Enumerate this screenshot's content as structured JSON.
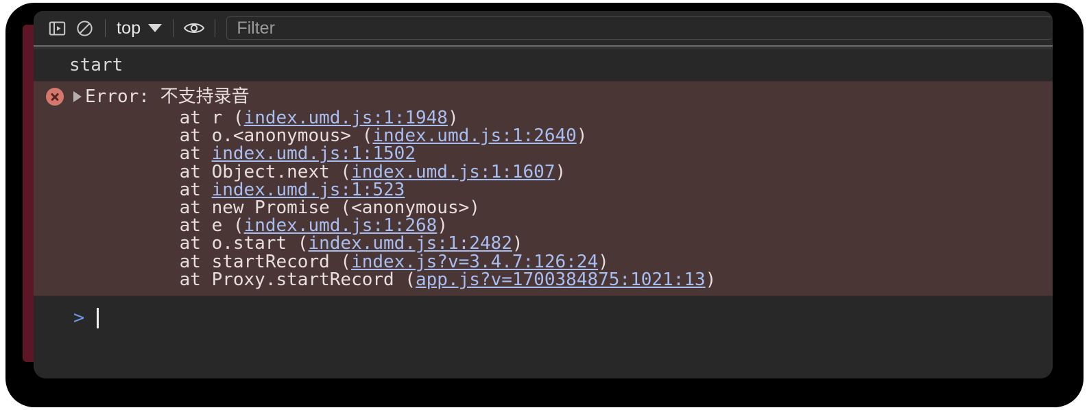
{
  "window": {
    "app": "Chrome DevTools Console"
  },
  "toolbar": {
    "sidebar_toggle_icon": "console-sidebar-icon",
    "clear_console_icon": "clear-console-icon",
    "context_label": "top",
    "context_caret_icon": "chevron-down-icon",
    "eye_icon": "live-expression-eye-icon",
    "filter_placeholder": "Filter",
    "filter_value": ""
  },
  "console": {
    "messages": [
      {
        "type": "log",
        "text": "start"
      },
      {
        "type": "error",
        "icon": "error-circle-icon",
        "expander_icon": "disclosure-triangle-icon",
        "title": "Error: 不支持录音",
        "stack": [
          {
            "prefix": "    at r (",
            "link": "index.umd.js:1:1948",
            "suffix": ")"
          },
          {
            "prefix": "    at o.<anonymous> (",
            "link": "index.umd.js:1:2640",
            "suffix": ")"
          },
          {
            "prefix": "    at ",
            "link": "index.umd.js:1:1502",
            "suffix": ""
          },
          {
            "prefix": "    at Object.next (",
            "link": "index.umd.js:1:1607",
            "suffix": ")"
          },
          {
            "prefix": "    at ",
            "link": "index.umd.js:1:523",
            "suffix": ""
          },
          {
            "prefix": "    at new Promise (<anonymous>)",
            "link": "",
            "suffix": ""
          },
          {
            "prefix": "    at e (",
            "link": "index.umd.js:1:268",
            "suffix": ")"
          },
          {
            "prefix": "    at o.start (",
            "link": "index.umd.js:1:2482",
            "suffix": ")"
          },
          {
            "prefix": "    at startRecord (",
            "link": "index.js?v=3.4.7:126:24",
            "suffix": ")"
          },
          {
            "prefix": "    at Proxy.startRecord (",
            "link": "app.js?v=1700384875:1021:13",
            "suffix": ")"
          }
        ]
      }
    ],
    "prompt_chevron": ">",
    "prompt_value": ""
  },
  "colors": {
    "frame": "#000000",
    "console_bg": "#282828",
    "error_bg": "#4a3634",
    "error_icon": "#d4786e",
    "link": "#a8bdf0",
    "prompt": "#6c96e0",
    "panel_edge": "#5e1524"
  }
}
